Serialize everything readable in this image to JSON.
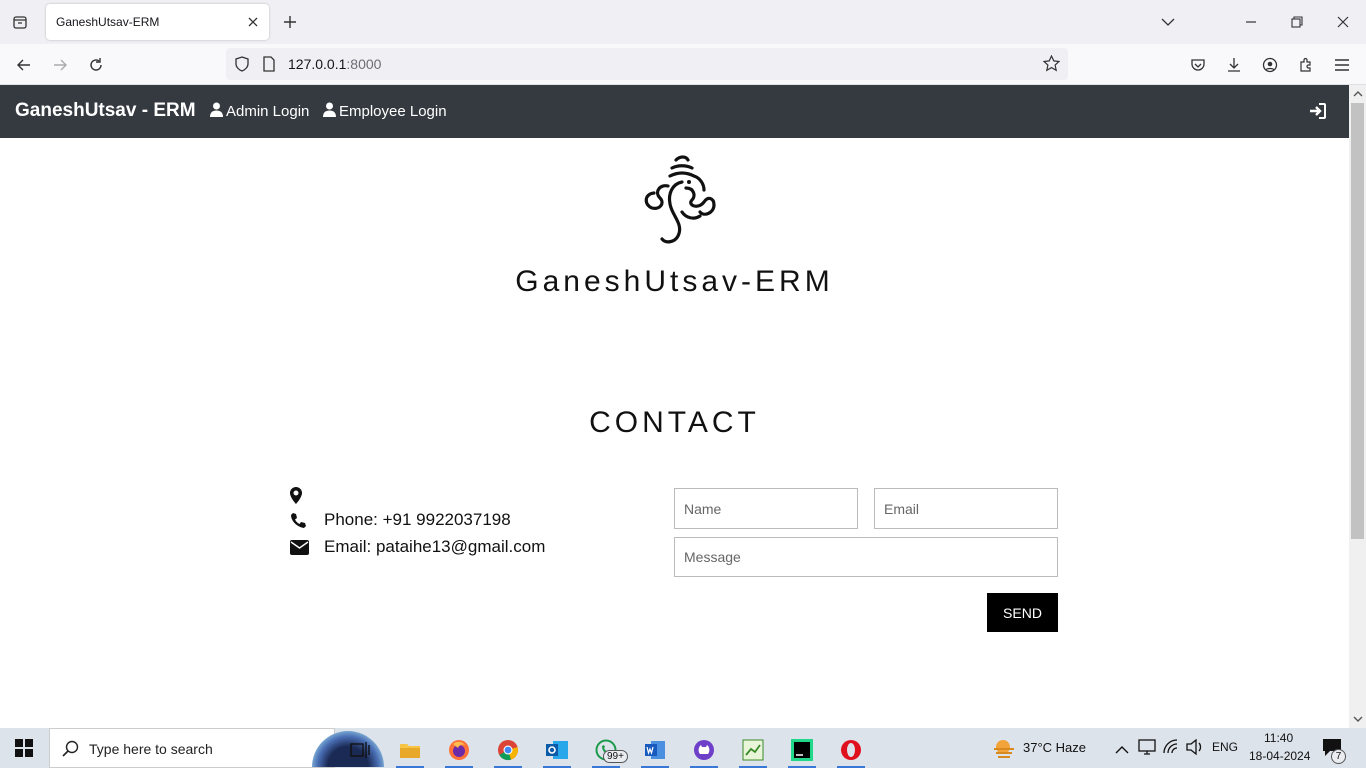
{
  "browser": {
    "tab_title": "GaneshUtsav-ERM",
    "url_host": "127.0.0.1",
    "url_port": ":8000"
  },
  "navbar": {
    "brand": "GaneshUtsav - ERM",
    "links": [
      "Admin Login",
      "Employee Login"
    ]
  },
  "header": {
    "site_title": "GaneshUtsav-ERM"
  },
  "contact": {
    "heading": "CONTACT",
    "location": "",
    "phone": "Phone: +91 9922037198",
    "email": "Email: pataihe13@gmail.com",
    "form": {
      "name_placeholder": "Name",
      "email_placeholder": "Email",
      "message_placeholder": "Message",
      "send_label": "SEND"
    }
  },
  "taskbar": {
    "search_placeholder": "Type here to search",
    "whatsapp_badge": "99+",
    "weather": "37°C  Haze",
    "language": "ENG",
    "time": "11:40",
    "date": "18-04-2024",
    "notification_count": "7"
  },
  "colors": {
    "navbar_bg": "#343a40",
    "button_bg": "#000000",
    "taskbar_bg": "#dde3ea"
  }
}
